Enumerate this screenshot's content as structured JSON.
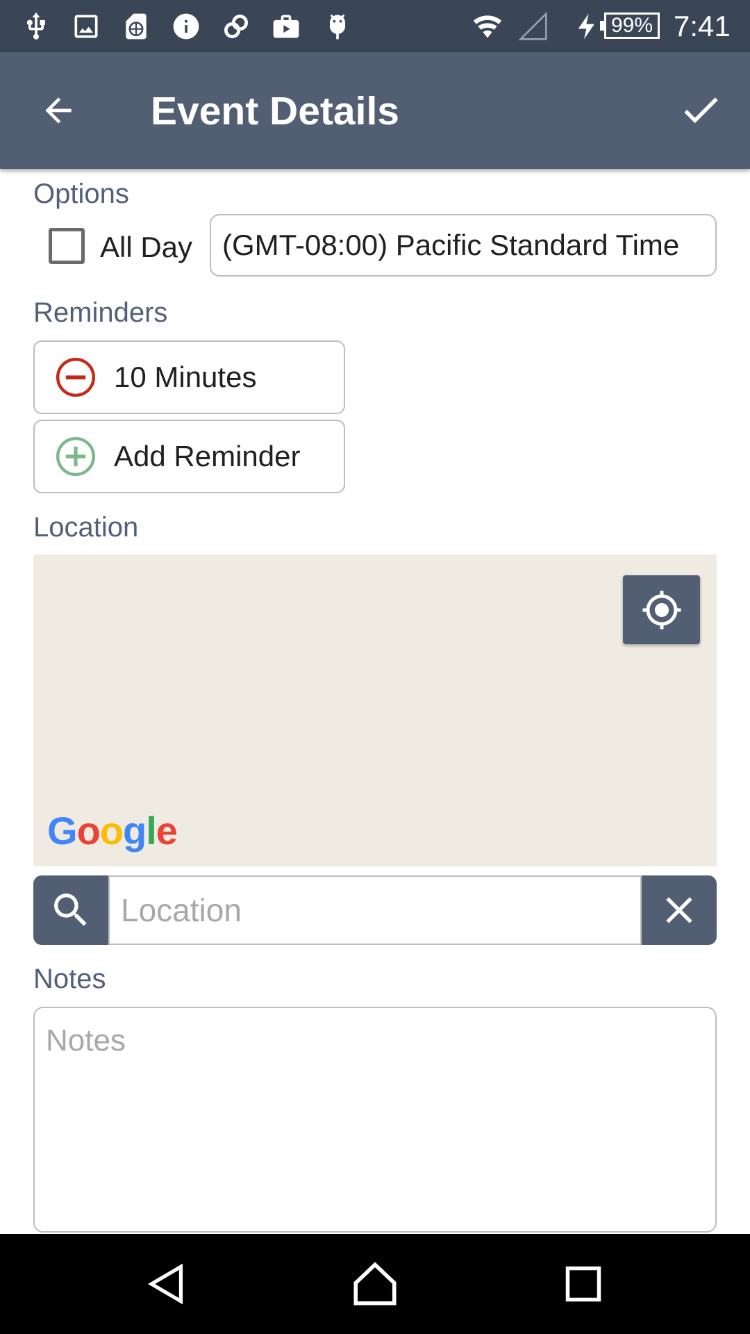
{
  "status_bar": {
    "battery": "99%",
    "time": "7:41",
    "icons": [
      "usb-icon",
      "image-icon",
      "sim-card-icon",
      "info-icon",
      "sync-icon",
      "briefcase-icon",
      "android-icon",
      "wifi-icon",
      "signal-icon",
      "charging-icon",
      "battery-icon"
    ]
  },
  "app_bar": {
    "title": "Event Details",
    "back_icon": "arrow-back-icon",
    "confirm_icon": "check-icon"
  },
  "options": {
    "label": "Options",
    "all_day_label": "All Day",
    "all_day_checked": false,
    "timezone": "(GMT-08:00) Pacific Standard Time"
  },
  "reminders": {
    "label": "Reminders",
    "items": [
      {
        "label": "10 Minutes",
        "icon": "remove-circle-icon"
      }
    ],
    "add_label": "Add Reminder",
    "add_icon": "add-circle-icon"
  },
  "location": {
    "label": "Location",
    "map_attribution": "Google",
    "my_location_icon": "my-location-icon",
    "search_icon": "search-icon",
    "clear_icon": "close-icon",
    "input_value": "",
    "input_placeholder": "Location"
  },
  "notes": {
    "label": "Notes",
    "value": "",
    "placeholder": "Notes"
  },
  "nav_bar": {
    "icons": [
      "back-triangle-icon",
      "home-icon",
      "recents-icon"
    ]
  },
  "colors": {
    "status_bar": "#3a4555",
    "app_bar": "#525f73",
    "label": "#536078",
    "remove_red": "#c62818",
    "add_green": "#7cb88a",
    "map_bg": "#efebe3"
  }
}
